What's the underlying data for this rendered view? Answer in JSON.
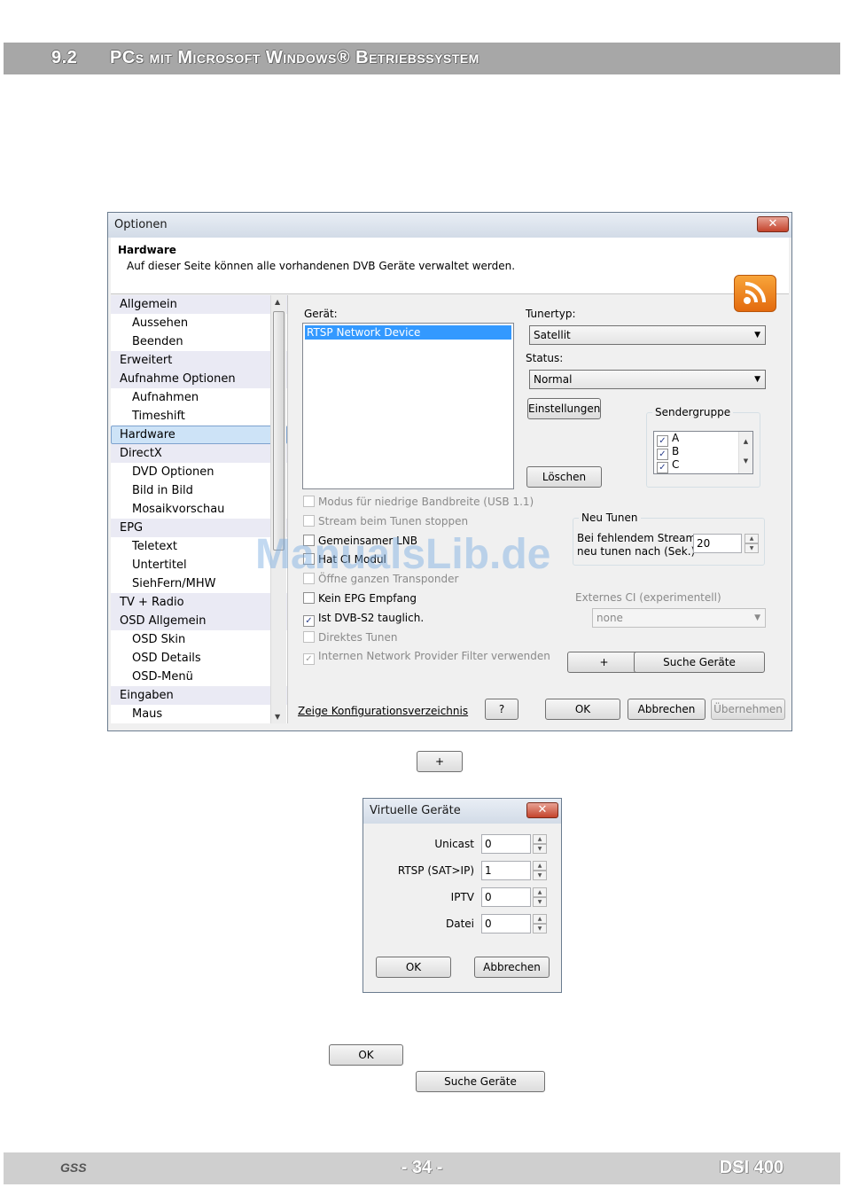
{
  "header": {
    "section_number": "9.2",
    "section_title": "PCs mit Microsoft Windows® Betriebssystem"
  },
  "options_dialog": {
    "title": "Optionen",
    "close": "✕",
    "page_heading": "Hardware",
    "page_desc": "Auf dieser Seite können alle vorhandenen DVB Geräte verwaltet werden.",
    "nav_items": [
      {
        "label": "Allgemein",
        "kind": "cat"
      },
      {
        "label": "Aussehen",
        "kind": "sub"
      },
      {
        "label": "Beenden",
        "kind": "sub"
      },
      {
        "label": "Erweitert",
        "kind": "cat"
      },
      {
        "label": "Aufnahme Optionen",
        "kind": "cat"
      },
      {
        "label": "Aufnahmen",
        "kind": "sub"
      },
      {
        "label": "Timeshift",
        "kind": "sub"
      },
      {
        "label": "Hardware",
        "kind": "sel"
      },
      {
        "label": "DirectX",
        "kind": "cat"
      },
      {
        "label": "DVD Optionen",
        "kind": "sub"
      },
      {
        "label": "Bild in Bild",
        "kind": "sub"
      },
      {
        "label": "Mosaikvorschau",
        "kind": "sub"
      },
      {
        "label": "EPG",
        "kind": "cat"
      },
      {
        "label": "Teletext",
        "kind": "sub"
      },
      {
        "label": "Untertitel",
        "kind": "sub"
      },
      {
        "label": "SiehFern/MHW",
        "kind": "sub"
      },
      {
        "label": "TV + Radio",
        "kind": "cat"
      },
      {
        "label": "OSD Allgemein",
        "kind": "cat"
      },
      {
        "label": "OSD Skin",
        "kind": "sub"
      },
      {
        "label": "OSD Details",
        "kind": "sub"
      },
      {
        "label": "OSD-Menü",
        "kind": "sub"
      },
      {
        "label": "Eingaben",
        "kind": "cat"
      },
      {
        "label": "Maus",
        "kind": "sub"
      }
    ],
    "device_label": "Gerät:",
    "device_item": "RTSP Network Device",
    "tunertyp_label": "Tunertyp:",
    "tunertyp_value": "Satellit",
    "status_label": "Status:",
    "status_value": "Normal",
    "einstellungen": "Einstellungen",
    "loeschen": "Löschen",
    "sendergruppe_label": "Sendergruppe",
    "groups": [
      "A",
      "B",
      "C"
    ],
    "options": [
      {
        "label": "Modus für niedrige Bandbreite (USB 1.1)",
        "checked": false,
        "disabled": true
      },
      {
        "label": "Stream beim Tunen stoppen",
        "checked": false,
        "disabled": true
      },
      {
        "label": "Gemeinsamer LNB",
        "checked": false,
        "disabled": false
      },
      {
        "label": "Hat CI Modul",
        "checked": false,
        "disabled": false
      },
      {
        "label": "Öffne ganzen Transponder",
        "checked": false,
        "disabled": true
      },
      {
        "label": "Kein EPG Empfang",
        "checked": false,
        "disabled": false
      },
      {
        "label": "Ist DVB-S2 tauglich.",
        "checked": true,
        "disabled": false
      },
      {
        "label": "Direktes Tunen",
        "checked": false,
        "disabled": true
      },
      {
        "label": "Internen Network Provider Filter verwenden",
        "checked": true,
        "disabled": true
      }
    ],
    "neu_tunen_label": "Neu Tunen",
    "neu_tunen_text1": "Bei fehlendem Stream",
    "neu_tunen_text2": "neu tunen nach (Sek.)",
    "neu_tunen_value": "20",
    "externes_ci_label": "Externes CI (experimentell)",
    "externes_ci_value": "none",
    "plus": "+",
    "suche_geraete": "Suche Geräte",
    "config_link": "Zeige Konfigurationsverzeichnis",
    "help": "?",
    "ok": "OK",
    "abbrechen": "Abbrechen",
    "uebernehmen": "Übernehmen"
  },
  "standalone_plus": "+",
  "virtual_dialog": {
    "title": "Virtuelle Geräte",
    "close": "✕",
    "fields": [
      {
        "label": "Unicast",
        "value": "0"
      },
      {
        "label": "RTSP (SAT>IP)",
        "value": "1"
      },
      {
        "label": "IPTV",
        "value": "0"
      },
      {
        "label": "Datei",
        "value": "0"
      }
    ],
    "ok": "OK",
    "abbrechen": "Abbrechen"
  },
  "standalone_ok": "OK",
  "standalone_suche": "Suche Geräte",
  "watermark": "ManualsLib.de",
  "footer": {
    "logo": "GSS",
    "page": "- 34 -",
    "product": "DSI 400"
  }
}
